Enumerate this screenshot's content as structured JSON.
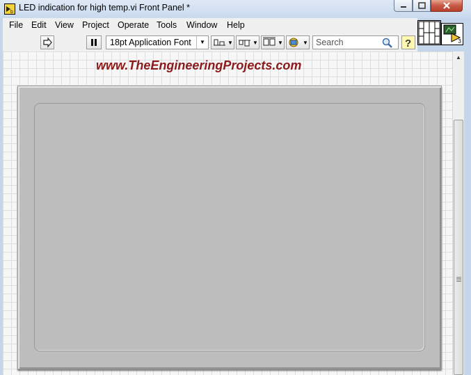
{
  "window": {
    "title": "LED indication for high temp.vi Front Panel *"
  },
  "menu": [
    "File",
    "Edit",
    "View",
    "Project",
    "Operate",
    "Tools",
    "Window",
    "Help"
  ],
  "toolbar": {
    "font_select": "18pt Application Font",
    "search_placeholder": "Search",
    "buttons": [
      "run-arrow-icon",
      "pause-icon",
      "align-objects-icon",
      "distribute-objects-icon",
      "resize-objects-icon",
      "reorder-icon",
      "search-icon",
      "help-icon"
    ]
  },
  "watermark": "www.TheEngineeringProjects.com",
  "vi_icon": {
    "terminal_count": "3"
  },
  "colors": {
    "watermark": "#8b1a1a",
    "panel": "#bdbdbd",
    "canvas": "#f7f7f7",
    "close_button": "#c75a45"
  }
}
